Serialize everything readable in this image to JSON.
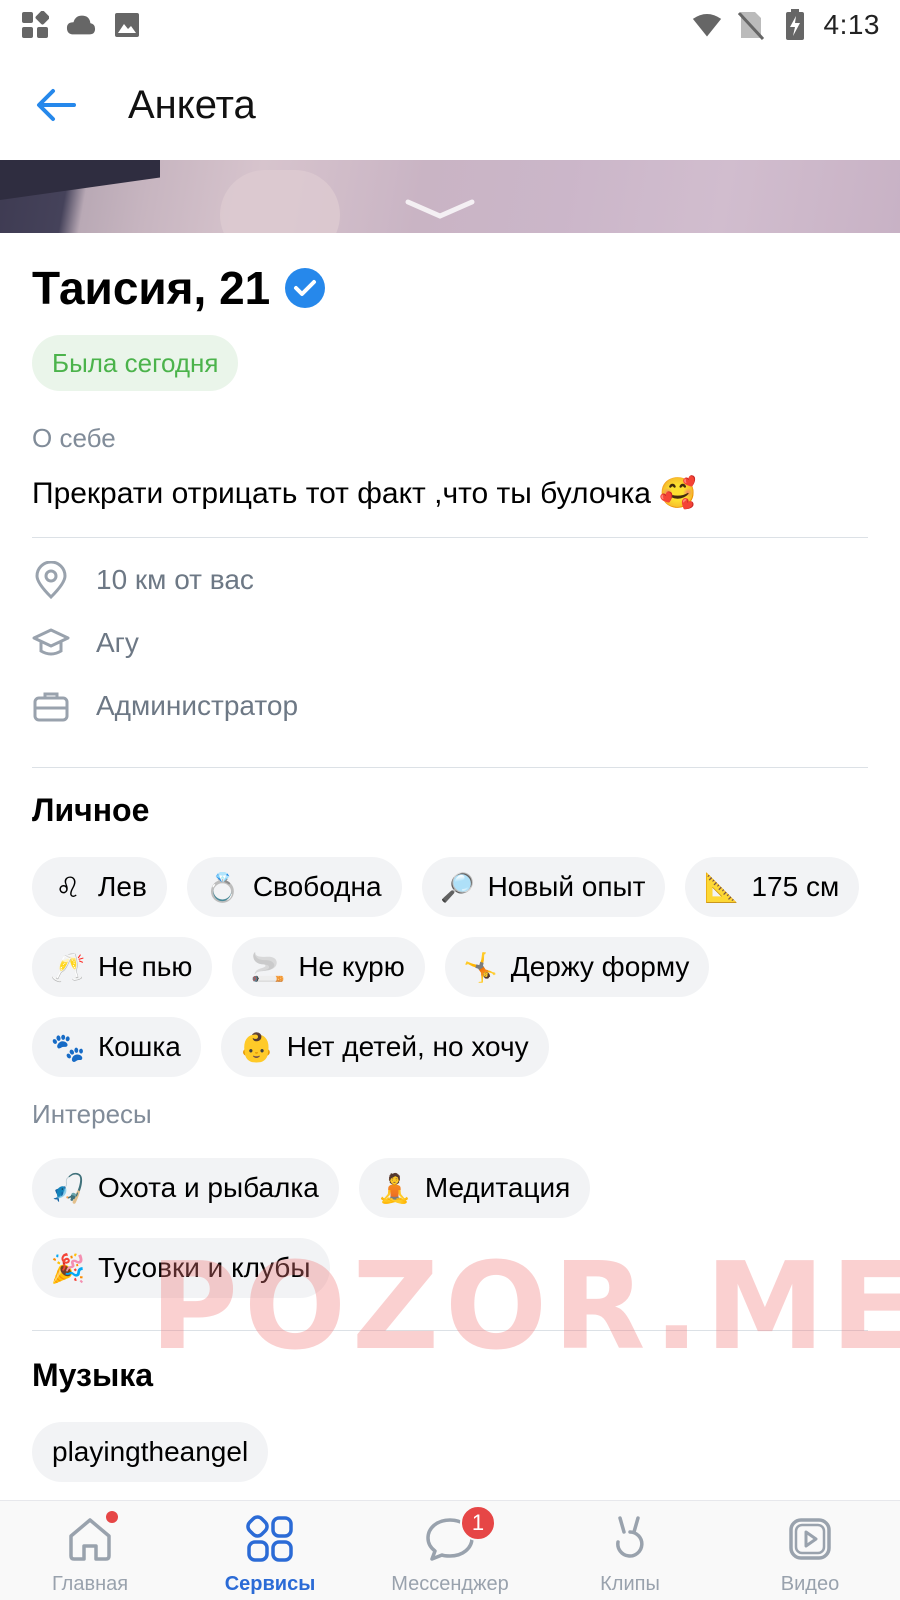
{
  "status_bar": {
    "time": "4:13"
  },
  "header": {
    "title": "Анкета"
  },
  "profile": {
    "name_age": "Таисия, 21",
    "online_status": "Была сегодня",
    "about_label": "О себе",
    "about_text": "Прекрати отрицать тот факт ,что ты булочка 🥰"
  },
  "info": {
    "distance": "10 км от вас",
    "education": "Агу",
    "job": "Администратор"
  },
  "personal": {
    "title": "Личное",
    "chips": [
      {
        "emoji": "♌",
        "label": "Лев"
      },
      {
        "emoji": "💍",
        "label": "Свободна"
      },
      {
        "emoji": "🔎",
        "label": "Новый опыт"
      },
      {
        "emoji": "📐",
        "label": "175 см"
      },
      {
        "emoji": "🥂",
        "label": "Не пью"
      },
      {
        "emoji": "🚬",
        "label": "Не курю"
      },
      {
        "emoji": "🤸",
        "label": "Держу форму"
      },
      {
        "emoji": "🐾",
        "label": "Кошка"
      },
      {
        "emoji": "👶",
        "label": "Нет детей, но хочу"
      }
    ]
  },
  "interests": {
    "title": "Интересы",
    "chips": [
      {
        "emoji": "🎣",
        "label": "Охота и рыбалка"
      },
      {
        "emoji": "🧘",
        "label": "Медитация"
      },
      {
        "emoji": "🎉",
        "label": "Тусовки и клубы"
      }
    ]
  },
  "music": {
    "title": "Музыка",
    "chips": [
      {
        "label": "playingtheangel"
      }
    ]
  },
  "watermark": "POZOR.ME",
  "bottom_nav": {
    "items": [
      {
        "label": "Главная",
        "icon": "home-icon"
      },
      {
        "label": "Сервисы",
        "icon": "services-icon"
      },
      {
        "label": "Мессенджер",
        "icon": "messenger-icon",
        "badge": "1"
      },
      {
        "label": "Клипы",
        "icon": "clips-icon"
      },
      {
        "label": "Видео",
        "icon": "video-icon"
      }
    ]
  },
  "colors": {
    "accent": "#2b6bd6",
    "online": "#4bb34b",
    "badge": "#e64646"
  }
}
